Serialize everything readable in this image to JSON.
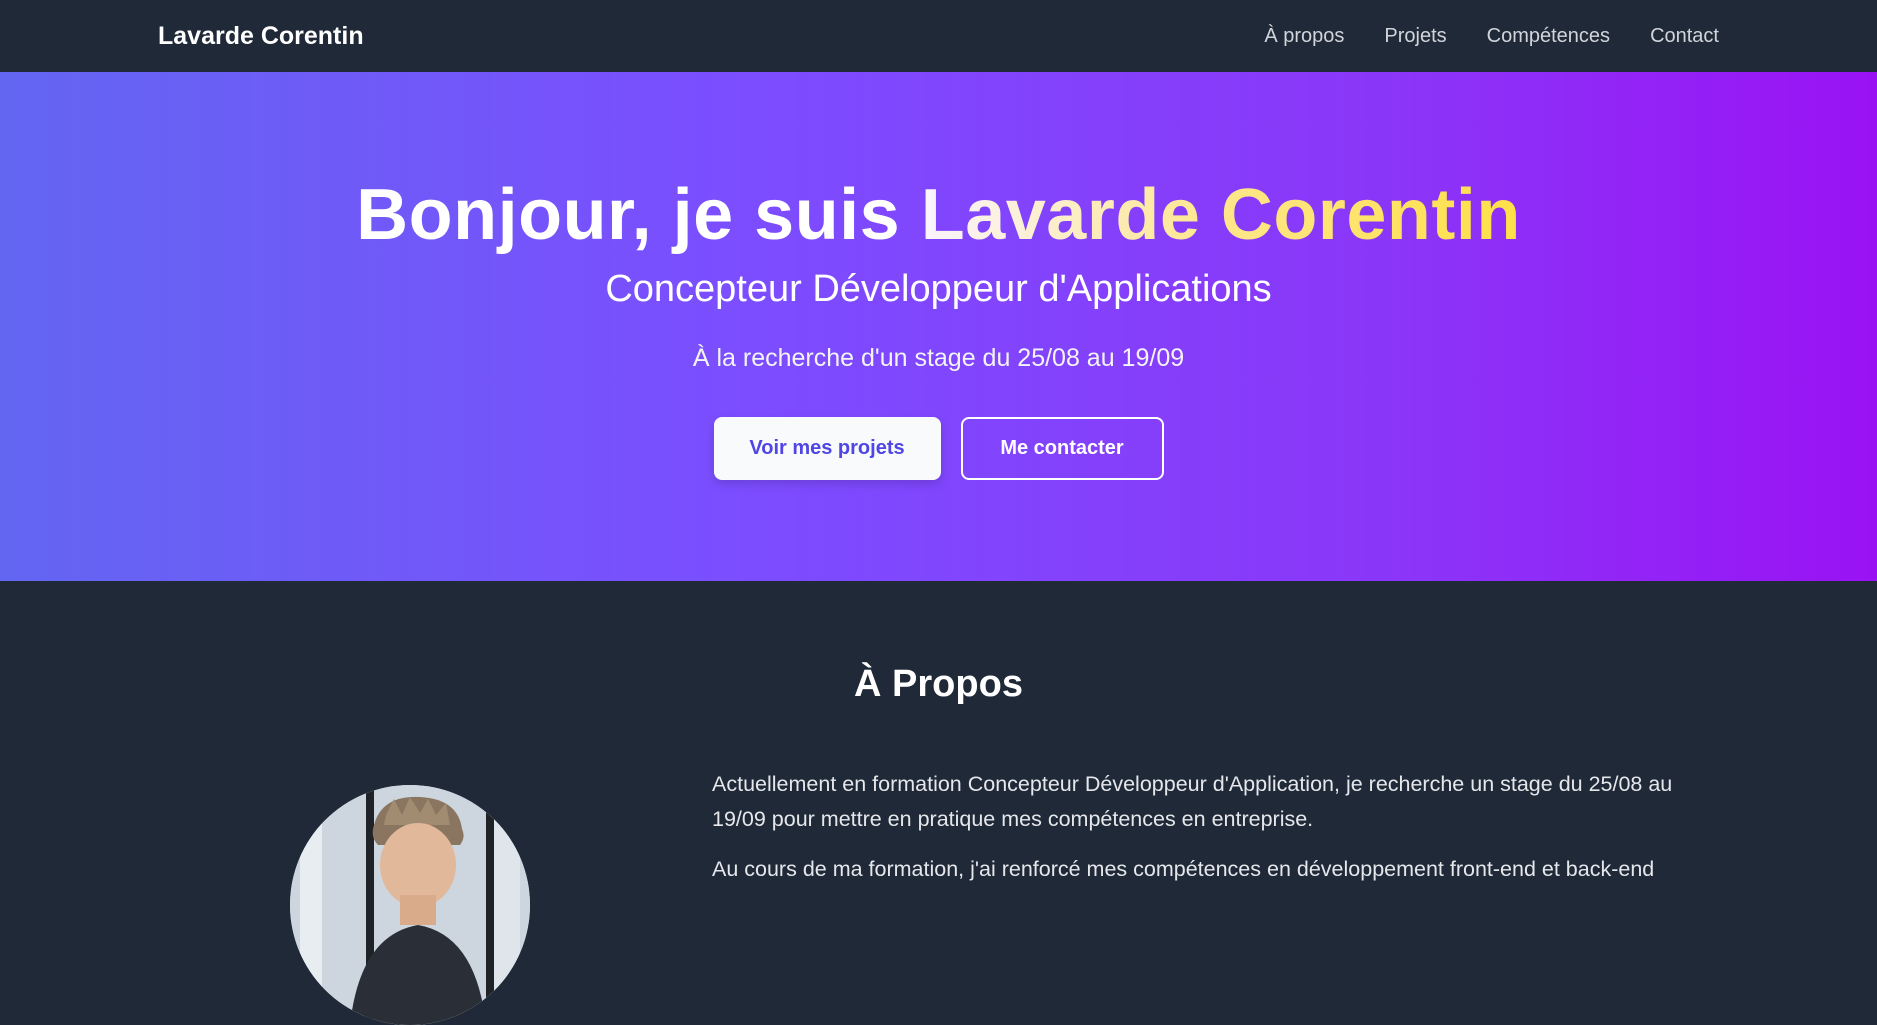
{
  "nav": {
    "brand": "Lavarde Corentin",
    "links": [
      "À propos",
      "Projets",
      "Compétences",
      "Contact"
    ]
  },
  "hero": {
    "title_prefix": "Bonjour, je suis ",
    "title_name": "Lavarde Corentin",
    "subtitle": "Concepteur Développeur d'Applications",
    "tagline": "À la recherche d'un stage du 25/08 au 19/09",
    "primary_button": "Voir mes projets",
    "secondary_button": "Me contacter"
  },
  "about": {
    "title": "À Propos",
    "paragraphs": [
      "Actuellement en formation Concepteur Développeur d'Application, je recherche un stage du 25/08 au 19/09 pour mettre en pratique mes compétences en entreprise.",
      "Au cours de ma formation, j'ai renforcé mes compétences en développement front-end et back-end"
    ]
  },
  "colors": {
    "nav_bg": "#1f2937",
    "hero_gradient_start": "#6366f1",
    "hero_gradient_end": "#9a12f4",
    "name_highlight": "#fde047",
    "primary_button_text": "#4f46e5"
  }
}
